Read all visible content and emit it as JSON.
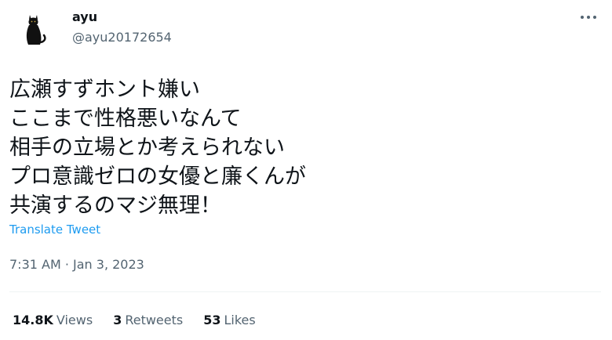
{
  "user": {
    "display_name": "ayu",
    "handle": "@ayu20172654",
    "avatar_icon": "black-cat-icon"
  },
  "tweet": {
    "lines": [
      "広瀬すずホント嫌い",
      "ここまで性格悪いなんて",
      "相手の立場とか考えられない",
      "プロ意識ゼロの女優と廉くんが",
      "共演するのマジ無理！"
    ],
    "translate_label": "Translate Tweet",
    "timestamp": "7:31 AM · Jan 3, 2023"
  },
  "stats": {
    "views_count": "14.8K",
    "views_label": "Views",
    "retweets_count": "3",
    "retweets_label": "Retweets",
    "likes_count": "53",
    "likes_label": "Likes"
  },
  "colors": {
    "text_primary": "#0f1419",
    "text_secondary": "#536471",
    "link": "#1d9bf0",
    "divider": "#eff3f4"
  },
  "icons": {
    "more": "more-options-icon"
  }
}
